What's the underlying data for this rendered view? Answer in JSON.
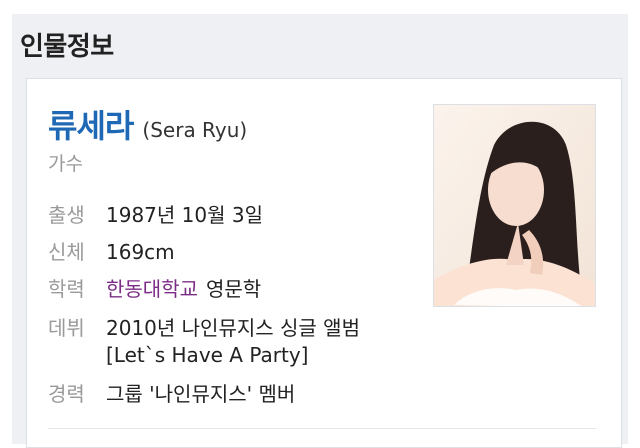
{
  "panel": {
    "title": "인물정보"
  },
  "person": {
    "name": "류세라",
    "name_en": "(Sera Ryu)",
    "job": "가수"
  },
  "info": [
    {
      "label": "출생",
      "value": "1987년 10월 3일"
    },
    {
      "label": "신체",
      "value": "169cm"
    },
    {
      "label": "학력",
      "link": "한동대학교",
      "value": "영문학"
    },
    {
      "label": "데뷔",
      "value": "2010년 나인뮤지스 싱글 앨범",
      "value_line2": "[Let`s Have A Party]"
    },
    {
      "label": "경력",
      "value": "그룹 '나인뮤지스' 멤버"
    }
  ],
  "photo": {
    "icon": "profile-photo"
  },
  "colors": {
    "name": "#1f68b6",
    "link": "#7b2c86",
    "label": "#9a9a9a"
  }
}
